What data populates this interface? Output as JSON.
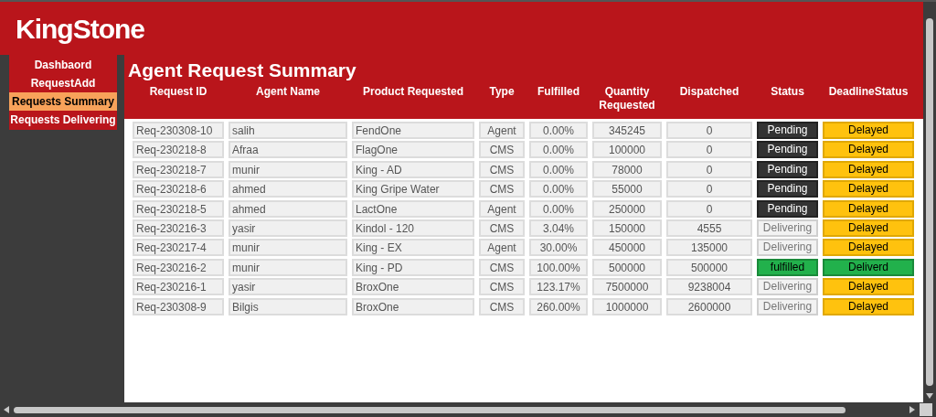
{
  "brand": "KingStone",
  "nav": [
    {
      "label": "Dashbaord",
      "selected": false
    },
    {
      "label": "RequestAdd",
      "selected": false
    },
    {
      "label": "Requests Summary",
      "selected": true
    },
    {
      "label": "Requests Delivering",
      "selected": false
    }
  ],
  "page_title": "Agent Request Summary",
  "table": {
    "columns": [
      "Request ID",
      "Agent Name",
      "Product Requested",
      "Type",
      "Fulfilled",
      "Quantity Requested",
      "Dispatched",
      "Status",
      "DeadlineStatus"
    ],
    "rows": [
      {
        "request_id": "Req-230308-10",
        "agent": "salih",
        "product": "FendOne",
        "type": "Agent",
        "fulfilled": "0.00%",
        "quantity": "345245",
        "dispatched": "0",
        "status": {
          "text": "Pending",
          "kind": "pending"
        },
        "deadline": {
          "text": "Delayed",
          "kind": "delayed"
        }
      },
      {
        "request_id": "Req-230218-8",
        "agent": "Afraa",
        "product": "FlagOne",
        "type": "CMS",
        "fulfilled": "0.00%",
        "quantity": "100000",
        "dispatched": "0",
        "status": {
          "text": "Pending",
          "kind": "pending"
        },
        "deadline": {
          "text": "Delayed",
          "kind": "delayed"
        }
      },
      {
        "request_id": "Req-230218-7",
        "agent": "munir",
        "product": "King - AD",
        "type": "CMS",
        "fulfilled": "0.00%",
        "quantity": "78000",
        "dispatched": "0",
        "status": {
          "text": "Pending",
          "kind": "pending"
        },
        "deadline": {
          "text": "Delayed",
          "kind": "delayed"
        }
      },
      {
        "request_id": "Req-230218-6",
        "agent": "ahmed",
        "product": "King Gripe Water",
        "type": "CMS",
        "fulfilled": "0.00%",
        "quantity": "55000",
        "dispatched": "0",
        "status": {
          "text": "Pending",
          "kind": "pending"
        },
        "deadline": {
          "text": "Delayed",
          "kind": "delayed"
        }
      },
      {
        "request_id": "Req-230218-5",
        "agent": "ahmed",
        "product": "LactOne",
        "type": "Agent",
        "fulfilled": "0.00%",
        "quantity": "250000",
        "dispatched": "0",
        "status": {
          "text": "Pending",
          "kind": "pending"
        },
        "deadline": {
          "text": "Delayed",
          "kind": "delayed"
        }
      },
      {
        "request_id": "Req-230216-3",
        "agent": "yasir",
        "product": "Kindol - 120",
        "type": "CMS",
        "fulfilled": "3.04%",
        "quantity": "150000",
        "dispatched": "4555",
        "status": {
          "text": "Delivering",
          "kind": "delivering"
        },
        "deadline": {
          "text": "Delayed",
          "kind": "delayed"
        }
      },
      {
        "request_id": "Req-230217-4",
        "agent": "munir",
        "product": "King - EX",
        "type": "Agent",
        "fulfilled": "30.00%",
        "quantity": "450000",
        "dispatched": "135000",
        "status": {
          "text": "Delivering",
          "kind": "delivering"
        },
        "deadline": {
          "text": "Delayed",
          "kind": "delayed"
        }
      },
      {
        "request_id": "Req-230216-2",
        "agent": "munir",
        "product": "King - PD",
        "type": "CMS",
        "fulfilled": "100.00%",
        "quantity": "500000",
        "dispatched": "500000",
        "status": {
          "text": "fulfilled",
          "kind": "fulfilled"
        },
        "deadline": {
          "text": "Deliverd",
          "kind": "delivered"
        }
      },
      {
        "request_id": "Req-230216-1",
        "agent": "yasir",
        "product": "BroxOne",
        "type": "CMS",
        "fulfilled": "123.17%",
        "quantity": "7500000",
        "dispatched": "9238004",
        "status": {
          "text": "Delivering",
          "kind": "delivering"
        },
        "deadline": {
          "text": "Delayed",
          "kind": "delayed"
        }
      },
      {
        "request_id": "Req-230308-9",
        "agent": "Bilgis",
        "product": "BroxOne",
        "type": "CMS",
        "fulfilled": "260.00%",
        "quantity": "1000000",
        "dispatched": "2600000",
        "status": {
          "text": "Delivering",
          "kind": "delivering"
        },
        "deadline": {
          "text": "Delayed",
          "kind": "delayed"
        }
      }
    ]
  }
}
